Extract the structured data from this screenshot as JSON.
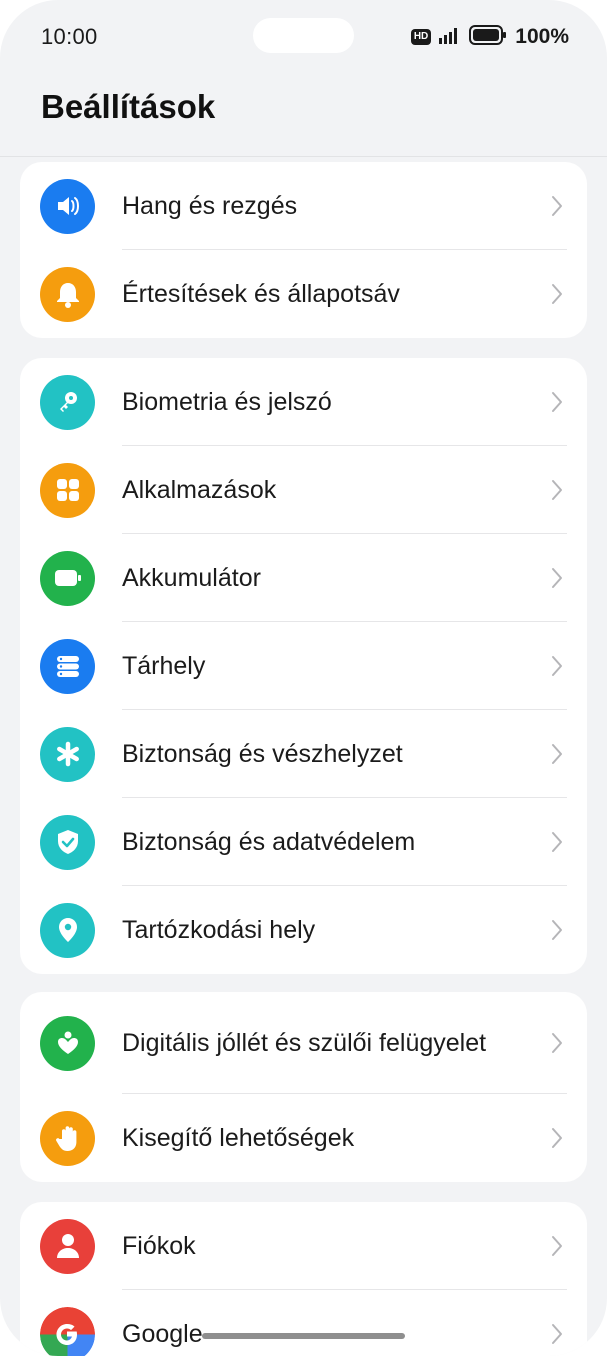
{
  "status": {
    "time": "10:00",
    "hd": "HD",
    "battery": "100%"
  },
  "header": {
    "title": "Beállítások"
  },
  "groups": [
    {
      "items": [
        {
          "label": "Hang és rezgés",
          "icon": "speaker-icon",
          "color": "#1a7cf0"
        },
        {
          "label": "Értesítések és állapotsáv",
          "icon": "bell-icon",
          "color": "#f59d0e"
        }
      ]
    },
    {
      "items": [
        {
          "label": "Biometria és jelszó",
          "icon": "key-icon",
          "color": "#22c2c4"
        },
        {
          "label": "Alkalmazások",
          "icon": "apps-grid-icon",
          "color": "#f59d0e"
        },
        {
          "label": "Akkumulátor",
          "icon": "battery-icon",
          "color": "#22b24c"
        },
        {
          "label": "Tárhely",
          "icon": "storage-icon",
          "color": "#1a7cf0"
        },
        {
          "label": "Biztonság és vészhelyzet",
          "icon": "asterisk-icon",
          "color": "#22c2c4"
        },
        {
          "label": "Biztonság és adatvédelem",
          "icon": "shield-icon",
          "color": "#22c2c4"
        },
        {
          "label": "Tartózkodási hely",
          "icon": "location-pin-icon",
          "color": "#22c2c4"
        }
      ]
    },
    {
      "items": [
        {
          "label": "Digitális jóllét és szülői felügyelet",
          "icon": "wellbeing-icon",
          "color": "#22b24c"
        },
        {
          "label": "Kisegítő lehetőségek",
          "icon": "hand-icon",
          "color": "#f59d0e"
        }
      ]
    },
    {
      "items": [
        {
          "label": "Fiókok",
          "icon": "person-icon",
          "color": "#e8403a"
        },
        {
          "label": "Google",
          "icon": "google-icon",
          "color": "#ffffff"
        }
      ]
    }
  ]
}
